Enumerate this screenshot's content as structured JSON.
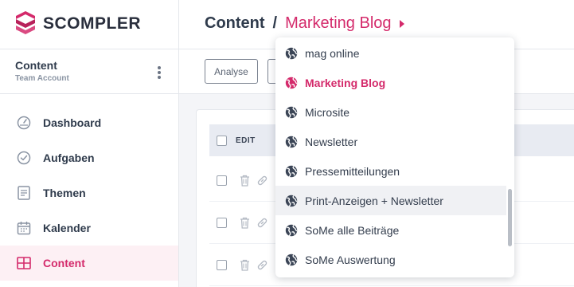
{
  "brand": {
    "name": "SCOMPLER",
    "accent": "#d42a6b"
  },
  "account": {
    "name": "Content",
    "type": "Team Account"
  },
  "sidebar": {
    "items": [
      {
        "label": "Dashboard",
        "icon": "gauge-icon"
      },
      {
        "label": "Aufgaben",
        "icon": "check-circle-icon"
      },
      {
        "label": "Themen",
        "icon": "document-icon"
      },
      {
        "label": "Kalender",
        "icon": "calendar-icon"
      },
      {
        "label": "Content",
        "icon": "grid-icon",
        "active": true
      }
    ]
  },
  "header": {
    "breadcrumb_root": "Content",
    "breadcrumb_separator": "/",
    "breadcrumb_current": "Marketing Blog"
  },
  "toolbar": {
    "analyse_label": "Analyse"
  },
  "table": {
    "columns": [
      "EDIT"
    ],
    "row_count_visible": 3
  },
  "dropdown": {
    "items": [
      {
        "label": "mag online"
      },
      {
        "label": "Marketing Blog",
        "selected": true
      },
      {
        "label": "Microsite"
      },
      {
        "label": "Newsletter"
      },
      {
        "label": "Pressemitteilungen"
      },
      {
        "label": "Print-Anzeigen + Newsletter",
        "hovered": true
      },
      {
        "label": "SoMe alle Beiträge"
      },
      {
        "label": "SoMe Auswertung"
      }
    ]
  }
}
